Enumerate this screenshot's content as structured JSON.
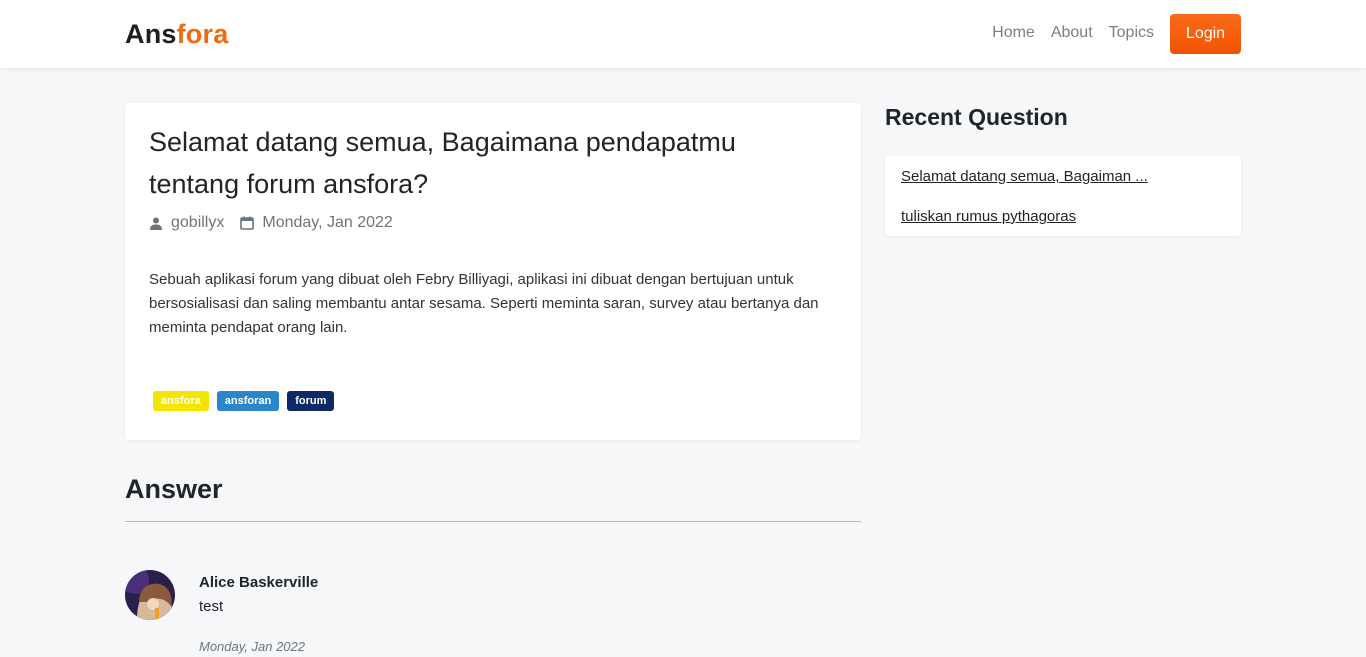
{
  "brand": {
    "part1": "Ans",
    "part2": "fora"
  },
  "nav": {
    "home": "Home",
    "about": "About",
    "topics": "Topics",
    "login": "Login"
  },
  "question": {
    "title": "Selamat datang semua, Bagaimana pendapatmu tentang forum ansfora?",
    "author": "gobillyx",
    "date": "Monday, Jan 2022",
    "body": "Sebuah aplikasi forum yang dibuat oleh Febry Billiyagi, aplikasi ini dibuat dengan bertujuan untuk bersosialisasi dan saling membantu antar sesama. Seperti meminta saran, survey atau bertanya dan meminta pendapat orang lain.",
    "tags": [
      "ansfora",
      "ansforan",
      "forum"
    ]
  },
  "answers": {
    "heading": "Answer",
    "items": [
      {
        "name": "Alice Baskerville",
        "text": "test",
        "date": "Monday, Jan 2022"
      }
    ]
  },
  "sidebar": {
    "heading": "Recent Question",
    "items": [
      "Selamat datang semua, Bagaiman ...",
      "tuliskan rumus pythagoras"
    ]
  },
  "colors": {
    "accent": "#f26a10",
    "tag_yellow": "#f2e600",
    "tag_blue": "#2a86c8",
    "tag_navy": "#0d2a66"
  }
}
